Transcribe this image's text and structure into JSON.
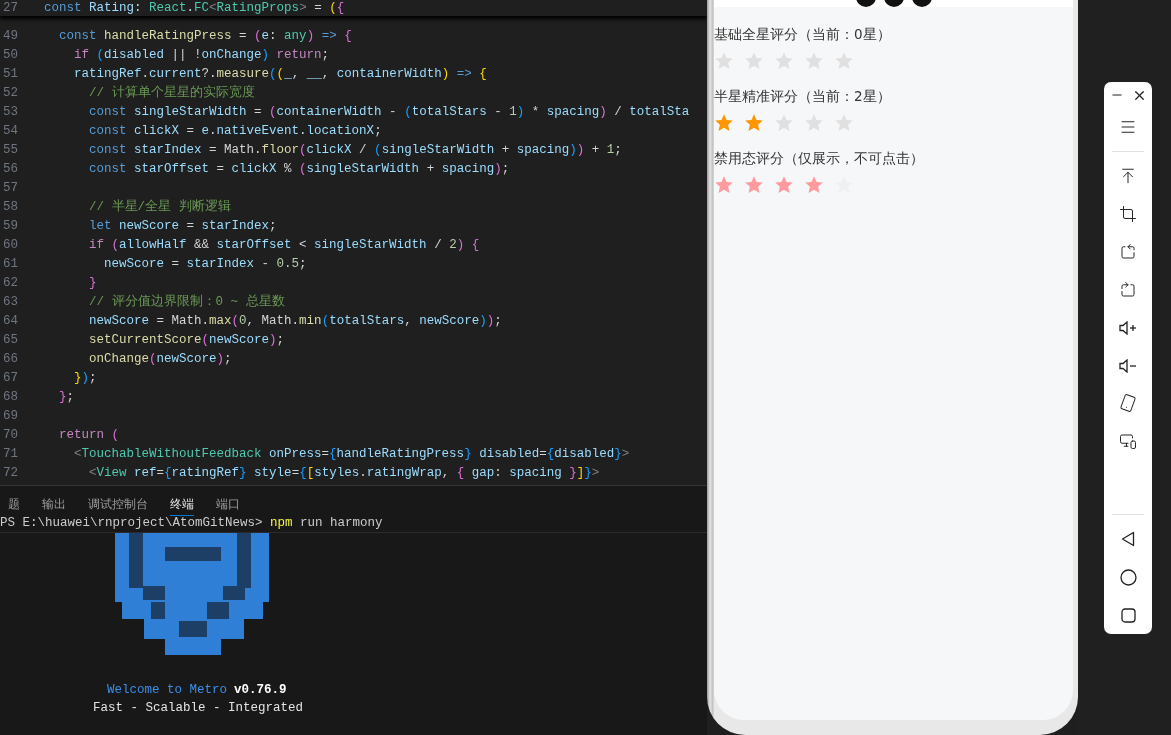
{
  "editor": {
    "sticky_line": {
      "number": "27",
      "tokens": [
        {
          "kind": "keyword",
          "text": "const "
        },
        {
          "kind": "variable",
          "text": "Rating"
        },
        {
          "kind": "plain",
          "text": ": "
        },
        {
          "kind": "type",
          "text": "React"
        },
        {
          "kind": "plain",
          "text": "."
        },
        {
          "kind": "type",
          "text": "FC"
        },
        {
          "kind": "tag",
          "text": "<"
        },
        {
          "kind": "type",
          "text": "RatingProps"
        },
        {
          "kind": "tag",
          "text": ">"
        },
        {
          "kind": "plain",
          "text": " = "
        },
        {
          "kind": "bracket1",
          "text": "("
        },
        {
          "kind": "bracket2",
          "text": "{"
        }
      ]
    },
    "lines": [
      {
        "number": "49",
        "tokens": [
          {
            "kind": "keyword",
            "text": "  const "
          },
          {
            "kind": "function",
            "text": "handleRatingPress"
          },
          {
            "kind": "plain",
            "text": " = "
          },
          {
            "kind": "bracket2",
            "text": "("
          },
          {
            "kind": "variable",
            "text": "e"
          },
          {
            "kind": "plain",
            "text": ": "
          },
          {
            "kind": "type",
            "text": "any"
          },
          {
            "kind": "bracket2",
            "text": ")"
          },
          {
            "kind": "keyword",
            "text": " => "
          },
          {
            "kind": "bracket2",
            "text": "{"
          }
        ]
      },
      {
        "number": "50",
        "tokens": [
          {
            "kind": "control",
            "text": "    if "
          },
          {
            "kind": "bracket3",
            "text": "("
          },
          {
            "kind": "variable",
            "text": "disabled"
          },
          {
            "kind": "plain",
            "text": " || !"
          },
          {
            "kind": "variable",
            "text": "onChange"
          },
          {
            "kind": "bracket3",
            "text": ")"
          },
          {
            "kind": "control",
            "text": " return"
          },
          {
            "kind": "plain",
            "text": ";"
          }
        ]
      },
      {
        "number": "51",
        "tokens": [
          {
            "kind": "variable",
            "text": "    ratingRef"
          },
          {
            "kind": "plain",
            "text": "."
          },
          {
            "kind": "variable",
            "text": "current"
          },
          {
            "kind": "plain",
            "text": "?."
          },
          {
            "kind": "function",
            "text": "measure"
          },
          {
            "kind": "bracket3",
            "text": "("
          },
          {
            "kind": "bracket1",
            "text": "("
          },
          {
            "kind": "variable",
            "text": "_"
          },
          {
            "kind": "plain",
            "text": ", "
          },
          {
            "kind": "variable",
            "text": "__"
          },
          {
            "kind": "plain",
            "text": ", "
          },
          {
            "kind": "variable",
            "text": "containerWidth"
          },
          {
            "kind": "bracket1",
            "text": ")"
          },
          {
            "kind": "keyword",
            "text": " => "
          },
          {
            "kind": "bracket1",
            "text": "{"
          }
        ]
      },
      {
        "number": "52",
        "tokens": [
          {
            "kind": "comment",
            "text": "      // 计算单个星星的实际宽度"
          }
        ]
      },
      {
        "number": "53",
        "tokens": [
          {
            "kind": "keyword",
            "text": "      const "
          },
          {
            "kind": "variable",
            "text": "singleStarWidth"
          },
          {
            "kind": "plain",
            "text": " = "
          },
          {
            "kind": "bracket2",
            "text": "("
          },
          {
            "kind": "variable",
            "text": "containerWidth"
          },
          {
            "kind": "plain",
            "text": " - "
          },
          {
            "kind": "bracket3",
            "text": "("
          },
          {
            "kind": "variable",
            "text": "totalStars"
          },
          {
            "kind": "plain",
            "text": " - "
          },
          {
            "kind": "number",
            "text": "1"
          },
          {
            "kind": "bracket3",
            "text": ")"
          },
          {
            "kind": "plain",
            "text": " * "
          },
          {
            "kind": "variable",
            "text": "spacing"
          },
          {
            "kind": "bracket2",
            "text": ")"
          },
          {
            "kind": "plain",
            "text": " / "
          },
          {
            "kind": "variable",
            "text": "totalSta"
          }
        ]
      },
      {
        "number": "54",
        "tokens": [
          {
            "kind": "keyword",
            "text": "      const "
          },
          {
            "kind": "variable",
            "text": "clickX"
          },
          {
            "kind": "plain",
            "text": " = "
          },
          {
            "kind": "variable",
            "text": "e"
          },
          {
            "kind": "plain",
            "text": "."
          },
          {
            "kind": "variable",
            "text": "nativeEvent"
          },
          {
            "kind": "plain",
            "text": "."
          },
          {
            "kind": "variable",
            "text": "locationX"
          },
          {
            "kind": "plain",
            "text": ";"
          }
        ]
      },
      {
        "number": "55",
        "tokens": [
          {
            "kind": "keyword",
            "text": "      const "
          },
          {
            "kind": "variable",
            "text": "starIndex"
          },
          {
            "kind": "plain",
            "text": " = Math."
          },
          {
            "kind": "function",
            "text": "floor"
          },
          {
            "kind": "bracket2",
            "text": "("
          },
          {
            "kind": "variable",
            "text": "clickX"
          },
          {
            "kind": "plain",
            "text": " / "
          },
          {
            "kind": "bracket3",
            "text": "("
          },
          {
            "kind": "variable",
            "text": "singleStarWidth"
          },
          {
            "kind": "plain",
            "text": " + "
          },
          {
            "kind": "variable",
            "text": "spacing"
          },
          {
            "kind": "bracket3",
            "text": ")"
          },
          {
            "kind": "bracket2",
            "text": ")"
          },
          {
            "kind": "plain",
            "text": " + "
          },
          {
            "kind": "number",
            "text": "1"
          },
          {
            "kind": "plain",
            "text": ";"
          }
        ]
      },
      {
        "number": "56",
        "tokens": [
          {
            "kind": "keyword",
            "text": "      const "
          },
          {
            "kind": "variable",
            "text": "starOffset"
          },
          {
            "kind": "plain",
            "text": " = "
          },
          {
            "kind": "variable",
            "text": "clickX"
          },
          {
            "kind": "plain",
            "text": " % "
          },
          {
            "kind": "bracket2",
            "text": "("
          },
          {
            "kind": "variable",
            "text": "singleStarWidth"
          },
          {
            "kind": "plain",
            "text": " + "
          },
          {
            "kind": "variable",
            "text": "spacing"
          },
          {
            "kind": "bracket2",
            "text": ")"
          },
          {
            "kind": "plain",
            "text": ";"
          }
        ]
      },
      {
        "number": "57"
      },
      {
        "number": "58",
        "tokens": [
          {
            "kind": "comment",
            "text": "      // 半星/全星 判断逻辑"
          }
        ]
      },
      {
        "number": "59",
        "tokens": [
          {
            "kind": "keyword",
            "text": "      let "
          },
          {
            "kind": "variable",
            "text": "newScore"
          },
          {
            "kind": "plain",
            "text": " = "
          },
          {
            "kind": "variable",
            "text": "starIndex"
          },
          {
            "kind": "plain",
            "text": ";"
          }
        ]
      },
      {
        "number": "60",
        "tokens": [
          {
            "kind": "control",
            "text": "      if "
          },
          {
            "kind": "bracket2",
            "text": "("
          },
          {
            "kind": "variable",
            "text": "allowHalf"
          },
          {
            "kind": "plain",
            "text": " && "
          },
          {
            "kind": "variable",
            "text": "starOffset"
          },
          {
            "kind": "plain",
            "text": " < "
          },
          {
            "kind": "variable",
            "text": "singleStarWidth"
          },
          {
            "kind": "plain",
            "text": " / "
          },
          {
            "kind": "number",
            "text": "2"
          },
          {
            "kind": "bracket2",
            "text": ")"
          },
          {
            "kind": "bracket2",
            "text": " {"
          }
        ]
      },
      {
        "number": "61",
        "tokens": [
          {
            "kind": "variable",
            "text": "        newScore"
          },
          {
            "kind": "plain",
            "text": " = "
          },
          {
            "kind": "variable",
            "text": "starIndex"
          },
          {
            "kind": "plain",
            "text": " - "
          },
          {
            "kind": "number",
            "text": "0.5"
          },
          {
            "kind": "plain",
            "text": ";"
          }
        ]
      },
      {
        "number": "62",
        "tokens": [
          {
            "kind": "bracket2",
            "text": "      }"
          }
        ]
      },
      {
        "number": "63",
        "tokens": [
          {
            "kind": "comment",
            "text": "      // 评分值边界限制：0 ~ 总星数"
          }
        ]
      },
      {
        "number": "64",
        "tokens": [
          {
            "kind": "variable",
            "text": "      newScore"
          },
          {
            "kind": "plain",
            "text": " = Math."
          },
          {
            "kind": "function",
            "text": "max"
          },
          {
            "kind": "bracket2",
            "text": "("
          },
          {
            "kind": "number",
            "text": "0"
          },
          {
            "kind": "plain",
            "text": ", Math."
          },
          {
            "kind": "function",
            "text": "min"
          },
          {
            "kind": "bracket3",
            "text": "("
          },
          {
            "kind": "variable",
            "text": "totalStars"
          },
          {
            "kind": "plain",
            "text": ", "
          },
          {
            "kind": "variable",
            "text": "newScore"
          },
          {
            "kind": "bracket3",
            "text": ")"
          },
          {
            "kind": "bracket2",
            "text": ")"
          },
          {
            "kind": "plain",
            "text": ";"
          }
        ]
      },
      {
        "number": "65",
        "tokens": [
          {
            "kind": "function",
            "text": "      setCurrentScore"
          },
          {
            "kind": "bracket2",
            "text": "("
          },
          {
            "kind": "variable",
            "text": "newScore"
          },
          {
            "kind": "bracket2",
            "text": ")"
          },
          {
            "kind": "plain",
            "text": ";"
          }
        ]
      },
      {
        "number": "66",
        "tokens": [
          {
            "kind": "function",
            "text": "      onChange"
          },
          {
            "kind": "bracket2",
            "text": "("
          },
          {
            "kind": "variable",
            "text": "newScore"
          },
          {
            "kind": "bracket2",
            "text": ")"
          },
          {
            "kind": "plain",
            "text": ";"
          }
        ]
      },
      {
        "number": "67",
        "tokens": [
          {
            "kind": "bracket1",
            "text": "    }"
          },
          {
            "kind": "bracket3",
            "text": ")"
          },
          {
            "kind": "plain",
            "text": ";"
          }
        ]
      },
      {
        "number": "68",
        "tokens": [
          {
            "kind": "bracket2",
            "text": "  }"
          },
          {
            "kind": "plain",
            "text": ";"
          }
        ]
      },
      {
        "number": "69"
      },
      {
        "number": "70",
        "tokens": [
          {
            "kind": "control",
            "text": "  return "
          },
          {
            "kind": "bracket2",
            "text": "("
          }
        ]
      },
      {
        "number": "71",
        "tokens": [
          {
            "kind": "tag",
            "text": "    <"
          },
          {
            "kind": "type",
            "text": "TouchableWithoutFeedback"
          },
          {
            "kind": "variable",
            "text": " onPress"
          },
          {
            "kind": "plain",
            "text": "="
          },
          {
            "kind": "bracket3",
            "text": "{"
          },
          {
            "kind": "variable",
            "text": "handleRatingPress"
          },
          {
            "kind": "bracket3",
            "text": "}"
          },
          {
            "kind": "variable",
            "text": " disabled"
          },
          {
            "kind": "plain",
            "text": "="
          },
          {
            "kind": "bracket3",
            "text": "{"
          },
          {
            "kind": "variable",
            "text": "disabled"
          },
          {
            "kind": "bracket3",
            "text": "}"
          },
          {
            "kind": "tag",
            "text": ">"
          }
        ]
      },
      {
        "number": "72",
        "tokens": [
          {
            "kind": "tag",
            "text": "      <"
          },
          {
            "kind": "type",
            "text": "View"
          },
          {
            "kind": "variable",
            "text": " ref"
          },
          {
            "kind": "plain",
            "text": "="
          },
          {
            "kind": "bracket3",
            "text": "{"
          },
          {
            "kind": "variable",
            "text": "ratingRef"
          },
          {
            "kind": "bracket3",
            "text": "}"
          },
          {
            "kind": "variable",
            "text": " style"
          },
          {
            "kind": "plain",
            "text": "="
          },
          {
            "kind": "bracket3",
            "text": "{"
          },
          {
            "kind": "bracket1",
            "text": "["
          },
          {
            "kind": "variable",
            "text": "styles"
          },
          {
            "kind": "plain",
            "text": "."
          },
          {
            "kind": "variable",
            "text": "ratingWrap"
          },
          {
            "kind": "plain",
            "text": ", "
          },
          {
            "kind": "bracket2",
            "text": "{ "
          },
          {
            "kind": "variable",
            "text": "gap"
          },
          {
            "kind": "plain",
            "text": ": "
          },
          {
            "kind": "variable",
            "text": "spacing"
          },
          {
            "kind": "bracket2",
            "text": " }"
          },
          {
            "kind": "bracket1",
            "text": "]"
          },
          {
            "kind": "bracket3",
            "text": "}"
          },
          {
            "kind": "tag",
            "text": ">"
          }
        ]
      }
    ]
  },
  "panel": {
    "tabs": [
      {
        "label": "题",
        "selected": false
      },
      {
        "label": "输出",
        "selected": false
      },
      {
        "label": "调试控制台",
        "selected": false
      },
      {
        "label": "终端",
        "selected": true
      },
      {
        "label": "端口",
        "selected": false
      }
    ],
    "terminal": {
      "prompt": "PS E:\\huawei\\rnproject\\AtomGitNews>",
      "command": "npm",
      "arguments": "run harmony",
      "welcome": "Welcome to Metro",
      "version": "v0.76.9",
      "tagline": "Fast - Scalable - Integrated"
    }
  },
  "phone": {
    "sections": [
      {
        "title": "基础全星评分（当前：0星）",
        "stars": 0,
        "disabled": false
      },
      {
        "title": "半星精准评分（当前：2星）",
        "stars": 2,
        "disabled": false
      },
      {
        "title": "禁用态评分（仅展示，不可点击）",
        "stars": 4,
        "disabled": true
      }
    ]
  }
}
